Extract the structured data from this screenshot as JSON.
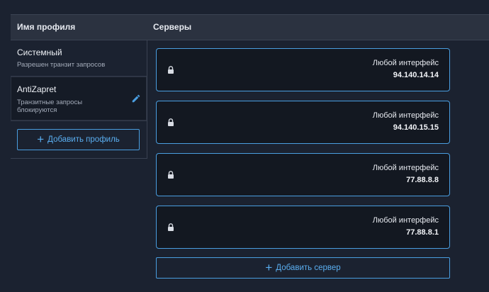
{
  "header": {
    "profile_col": "Имя профиля",
    "servers_col": "Серверы"
  },
  "profiles": [
    {
      "name": "Системный",
      "description": "Разрешен транзит запросов"
    },
    {
      "name": "AntiZapret",
      "description": "Транзитные запросы блокируются"
    }
  ],
  "add_profile_label": "Добавить профиль",
  "servers": [
    {
      "interface": "Любой интерфейс",
      "ip": "94.140.14.14"
    },
    {
      "interface": "Любой интерфейс",
      "ip": "94.140.15.15"
    },
    {
      "interface": "Любой интерфейс",
      "ip": "77.88.8.8"
    },
    {
      "interface": "Любой интерфейс",
      "ip": "77.88.8.1"
    }
  ],
  "add_server_label": "Добавить сервер",
  "icons": {
    "lock": "lock-icon",
    "edit": "pencil-icon",
    "plus": "plus-icon"
  },
  "colors": {
    "accent": "#4a9ee0",
    "background": "#1b2230",
    "header_bg": "#2b3240",
    "card_bg": "#131821"
  }
}
